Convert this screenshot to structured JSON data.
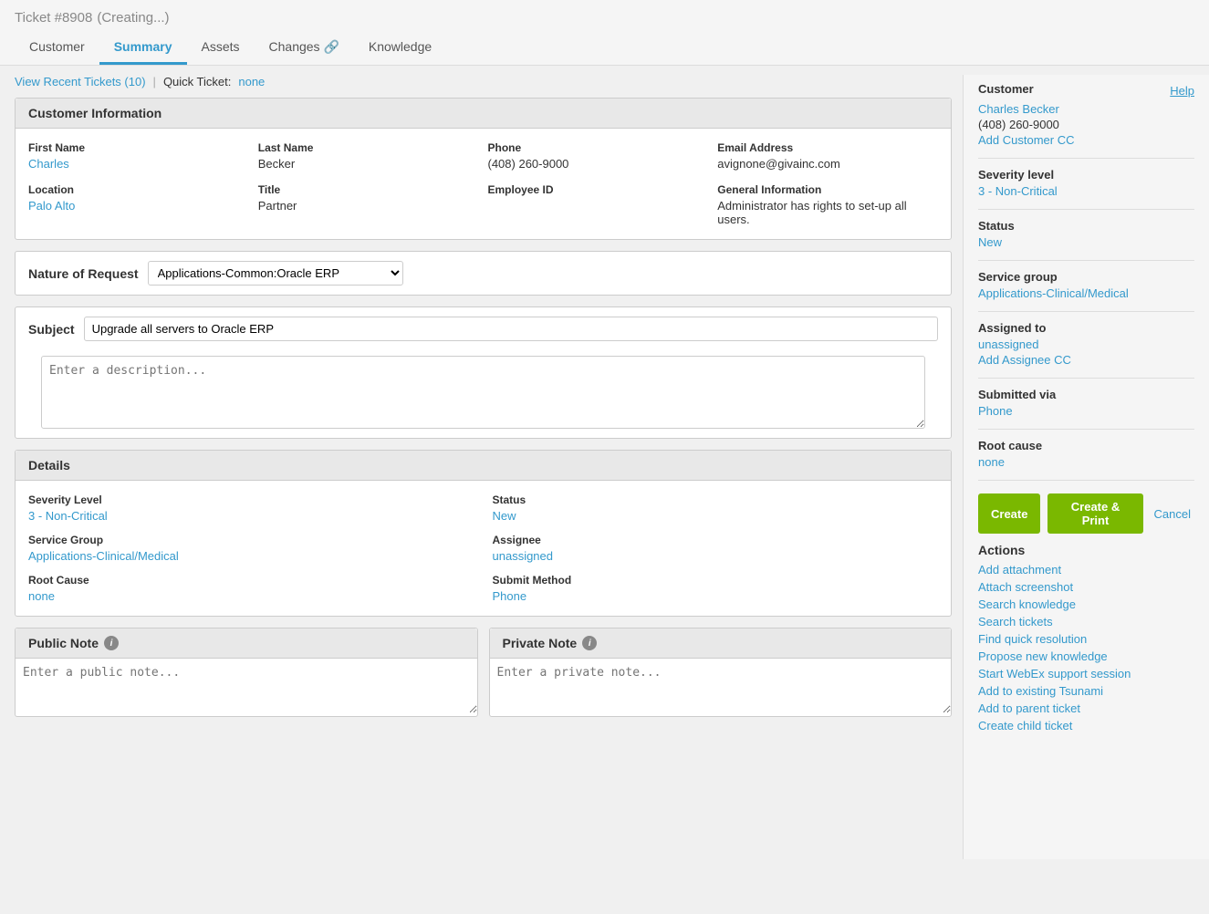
{
  "header": {
    "ticket_number": "Ticket #8908",
    "status_label": "(Creating...)",
    "tabs": [
      {
        "id": "customer",
        "label": "Customer",
        "active": false
      },
      {
        "id": "summary",
        "label": "Summary",
        "active": true
      },
      {
        "id": "assets",
        "label": "Assets",
        "active": false
      },
      {
        "id": "changes",
        "label": "Changes 🔗",
        "active": false
      },
      {
        "id": "knowledge",
        "label": "Knowledge",
        "active": false
      }
    ]
  },
  "quick_bar": {
    "recent_tickets": "View Recent Tickets (10)",
    "quick_ticket_label": "Quick Ticket:",
    "quick_ticket_value": "none"
  },
  "customer_info": {
    "section_title": "Customer Information",
    "fields": [
      {
        "label": "First Name",
        "value": "Charles",
        "link": true
      },
      {
        "label": "Last Name",
        "value": "Becker",
        "link": false
      },
      {
        "label": "Phone",
        "value": "(408) 260-9000",
        "link": false
      },
      {
        "label": "Email Address",
        "value": "avignone@givainc.com",
        "link": false
      },
      {
        "label": "Location",
        "value": "Palo Alto",
        "link": true
      },
      {
        "label": "Title",
        "value": "Partner",
        "link": false
      },
      {
        "label": "Employee ID",
        "value": "",
        "link": false
      },
      {
        "label": "General Information",
        "value": "Administrator has rights to set-up all users.",
        "link": false
      }
    ]
  },
  "nature_of_request": {
    "label": "Nature of Request",
    "value": "Applications-Common:Oracle ERP"
  },
  "subject": {
    "label": "Subject",
    "value": "Upgrade all servers to Oracle ERP"
  },
  "description": {
    "placeholder": "Enter a description..."
  },
  "details": {
    "section_title": "Details",
    "items": [
      {
        "label": "Severity Level",
        "value": "3 - Non-Critical",
        "link": true,
        "col": 1
      },
      {
        "label": "Status",
        "value": "New",
        "link": true,
        "col": 2
      },
      {
        "label": "Service Group",
        "value": "Applications-Clinical/Medical",
        "link": true,
        "col": 1
      },
      {
        "label": "Assignee",
        "value": "unassigned",
        "link": true,
        "col": 2
      },
      {
        "label": "Root Cause",
        "value": "none",
        "link": true,
        "col": 1
      },
      {
        "label": "Submit Method",
        "value": "Phone",
        "link": true,
        "col": 2
      }
    ]
  },
  "notes": {
    "public": {
      "label": "Public Note",
      "placeholder": "Enter a public note..."
    },
    "private": {
      "label": "Private Note",
      "placeholder": "Enter a private note..."
    }
  },
  "right_panel": {
    "customer": {
      "label": "Customer",
      "help": "Help",
      "name": "Charles Becker",
      "phone": "(408) 260-9000",
      "add_cc": "Add Customer CC"
    },
    "severity": {
      "label": "Severity level",
      "value": "3 - Non-Critical"
    },
    "status": {
      "label": "Status",
      "value": "New"
    },
    "service_group": {
      "label": "Service group",
      "value": "Applications-Clinical/Medical"
    },
    "assigned_to": {
      "label": "Assigned to",
      "value": "unassigned",
      "add_cc": "Add Assignee CC"
    },
    "submitted_via": {
      "label": "Submitted via",
      "value": "Phone"
    },
    "root_cause": {
      "label": "Root cause",
      "value": "none"
    },
    "buttons": {
      "create": "Create",
      "create_print": "Create & Print",
      "cancel": "Cancel"
    },
    "actions": {
      "label": "Actions",
      "items": [
        "Add attachment",
        "Attach screenshot",
        "Search knowledge",
        "Search tickets",
        "Find quick resolution",
        "Propose new knowledge",
        "Start WebEx support session",
        "Add to existing Tsunami",
        "Add to parent ticket",
        "Create child ticket"
      ]
    }
  }
}
